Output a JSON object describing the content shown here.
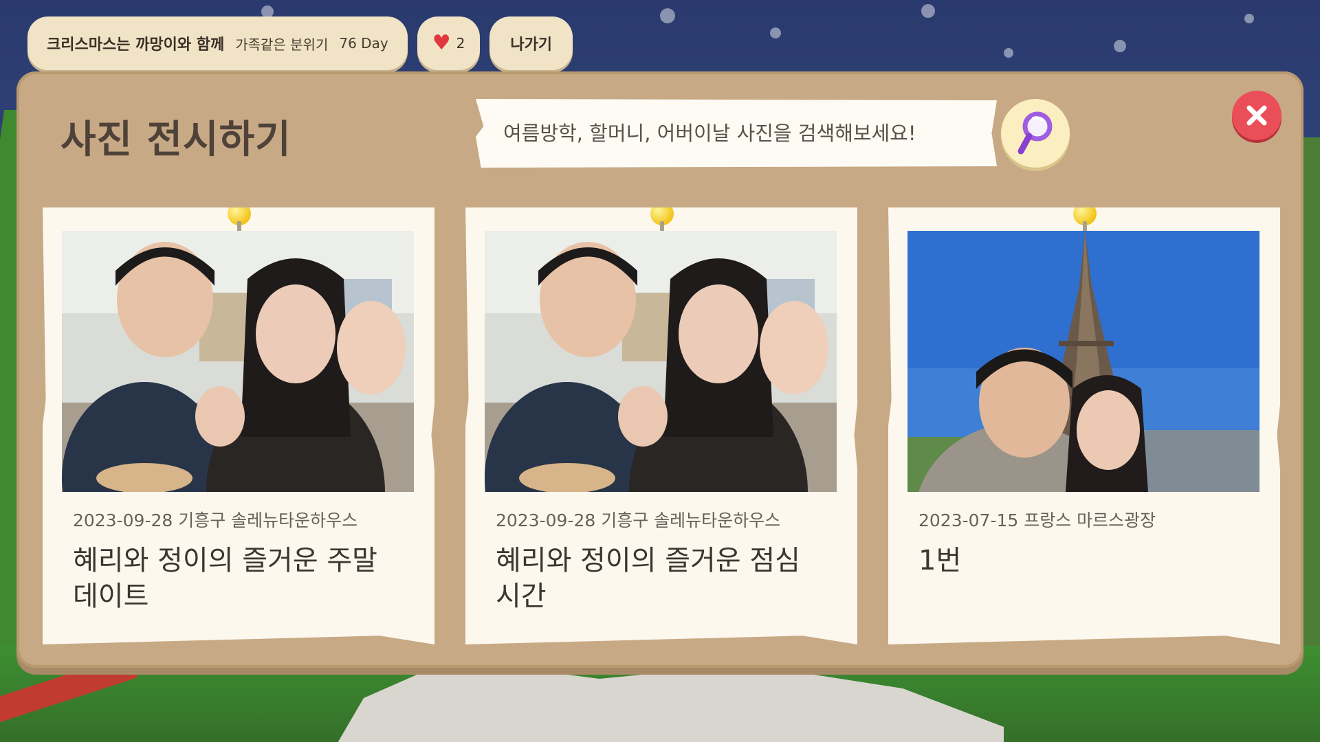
{
  "topbar": {
    "room_title": "크리스마스는 까망이와 함께",
    "room_sub": "가족같은 분위기",
    "room_day": "76 Day",
    "likes": "2",
    "exit_label": "나가기"
  },
  "panel": {
    "title": "사진 전시하기",
    "search_placeholder": "여름방학, 할머니, 어버이날 사진을 검색해보세요!"
  },
  "cards": [
    {
      "meta": "2023-09-28 기흥구 솔레뉴타운하우스",
      "caption": "혜리와 정이의 즐거운 주말 데이트",
      "photo": "couple-cafe-selfie"
    },
    {
      "meta": "2023-09-28 기흥구 솔레뉴타운하우스",
      "caption": "혜리와 정이의 즐거운 점심시간",
      "photo": "couple-cafe-selfie"
    },
    {
      "meta": "2023-07-15  프랑스 마르스광장",
      "caption": "1번",
      "photo": "couple-eiffel-tower"
    }
  ],
  "colors": {
    "panel_bg": "#c8a985",
    "card_bg": "#fdf8ee",
    "close_red": "#ea4e58",
    "heart": "#e0383e"
  },
  "icons": {
    "like": "heart-icon",
    "search": "magnifier-icon",
    "close": "close-icon",
    "pin": "pushpin-icon"
  }
}
